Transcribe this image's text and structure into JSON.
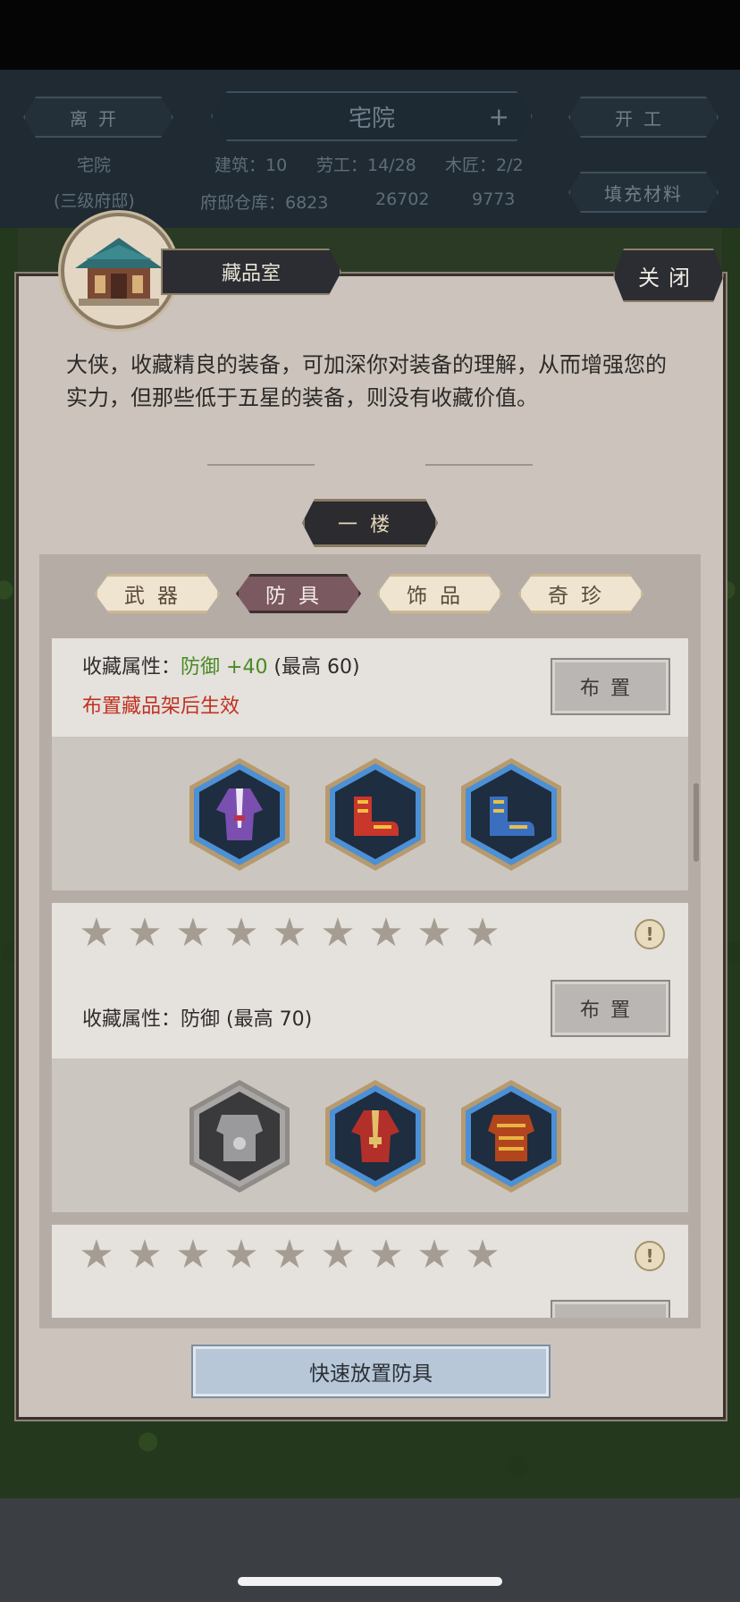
{
  "hud": {
    "leave_label": "离开",
    "title": "宅院",
    "start_work_label": "开工",
    "subtitle": "宅院",
    "level_note": "(三级府邸)",
    "buildings": "建筑：10",
    "labor": "劳工：14/28",
    "carpenter": "木匠：2/2",
    "warehouse": "府邸仓库：6823",
    "res2": "26702",
    "res3": "9773",
    "fill_label": "填充材料"
  },
  "dialog": {
    "title": "藏品室",
    "close_label": "关闭",
    "description": "大侠，收藏精良的装备，可加深你对装备的理解，从而增强您的实力，但那些低于五星的装备，则没有收藏价值。",
    "floor_label": "一楼"
  },
  "tabs": [
    {
      "label": "武器",
      "active": false
    },
    {
      "label": "防具",
      "active": true
    },
    {
      "label": "饰品",
      "active": false
    },
    {
      "label": "奇珍",
      "active": false
    }
  ],
  "cards": [
    {
      "attr_prefix": "收藏属性：",
      "attr_stat": "防御 +40",
      "attr_suffix": " (最高 60)",
      "effect_hint": "布置藏品架后生效",
      "place_label": "布置",
      "items": [
        "purple-robe",
        "red-gold-boots",
        "blue-gold-boots"
      ]
    },
    {
      "stars": 9,
      "attr_prefix": "收藏属性：",
      "attr_stat": "防御",
      "attr_suffix": " (最高 70)",
      "place_label": "布置",
      "items": [
        "silver-armor-empty",
        "red-robe",
        "gold-red-armor"
      ]
    },
    {
      "stars": 9
    }
  ],
  "quick_place_label": "快速放置防具",
  "colors": {
    "panel_bg": "#cbc3bc",
    "active_tab": "#7a5961",
    "inactive_tab": "#eee4cf",
    "green_stat": "#4a8a22",
    "red_hint": "#c03220",
    "quick_button": "#b7c7d8"
  }
}
